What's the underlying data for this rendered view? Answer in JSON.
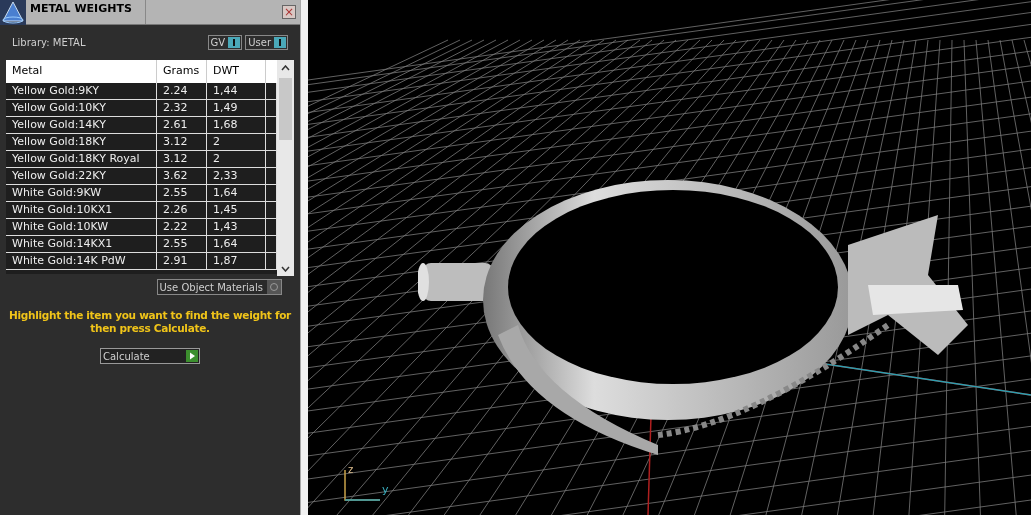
{
  "panel": {
    "title": "METAL WEIGHTS",
    "close": "×",
    "library_label": "Library: METAL",
    "toggles": [
      {
        "label": "GV",
        "on": true
      },
      {
        "label": "User",
        "on": true
      }
    ]
  },
  "table": {
    "columns": [
      "Metal",
      "Grams",
      "DWT"
    ],
    "rows": [
      {
        "cells": [
          "Yellow Gold:9KY",
          "2.24",
          "1,44"
        ]
      },
      {
        "cells": [
          "Yellow Gold:10KY",
          "2.32",
          "1,49"
        ]
      },
      {
        "cells": [
          "Yellow Gold:14KY",
          "2.61",
          "1,68"
        ]
      },
      {
        "cells": [
          "Yellow Gold:18KY",
          "3.12",
          "2"
        ]
      },
      {
        "cells": [
          "Yellow Gold:18KY Royal",
          "3.12",
          "2"
        ]
      },
      {
        "cells": [
          "Yellow Gold:22KY",
          "3.62",
          "2,33"
        ]
      },
      {
        "cells": [
          "White Gold:9KW",
          "2.55",
          "1,64"
        ]
      },
      {
        "cells": [
          "White Gold:10KX1",
          "2.26",
          "1,45"
        ]
      },
      {
        "cells": [
          "White Gold:10KW",
          "2.22",
          "1,43"
        ]
      },
      {
        "cells": [
          "White Gold:14KX1",
          "2.55",
          "1,64"
        ]
      },
      {
        "cells": [
          "White Gold:14K PdW",
          "2.91",
          "1,87"
        ]
      }
    ]
  },
  "use_object_materials": {
    "label": "Use Object Materials",
    "checked": false
  },
  "hint": "Highlight the item you want to find the weight for then press Calculate.",
  "calculate_button": "Calculate",
  "viewport": {
    "axis_labels": [
      "z",
      "y"
    ]
  }
}
